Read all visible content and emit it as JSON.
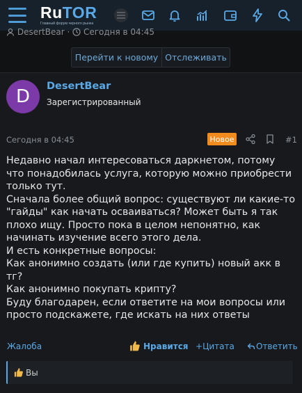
{
  "nav": {
    "logo_ru": "Ru",
    "logo_tor": "TOR",
    "logo_tagline": "Главный форум черного рынка",
    "icons": [
      "hamburger-icon",
      "mail-icon",
      "bell-icon",
      "chart-icon",
      "wallet-icon",
      "lightning-icon",
      "search-icon"
    ]
  },
  "thread": {
    "meta_author": "DesertBear",
    "meta_date": "Сегодня в 04:45"
  },
  "buttons": {
    "goto_new": "Перейти к новому",
    "watch": "Отслеживать"
  },
  "post": {
    "avatar_letter": "D",
    "username": "DesertBear",
    "user_title": "Зарегистрированный",
    "date": "Сегодня в 04:45",
    "new_badge": "Новое",
    "post_number": "#1",
    "message_lines": [
      "Недавно начал интересоваться даркнетом, потому что понадобилась услуга, которую можно приобрести только тут.",
      "Сначала более общий вопрос: существуют ли какие-то \"гайды\" как начать осваиваться? Может быть я так плохо ищу. Просто пока в целом непонятно, как начинать изучение всего этого дела.",
      "И есть конкретные вопросы:",
      "Как анонимно создать (или где купить) новый акк в тг?",
      "Как анонимно покупать крипту?",
      "Буду благодарен, если ответите на мои вопросы или просто подскажете, где искать на них ответы"
    ],
    "actions": {
      "report": "Жалоба",
      "like": "Нравится",
      "quote": "Цитата",
      "reply": "Ответить"
    },
    "likes_text": "Вы"
  },
  "colors": {
    "accent": "#5aa9e6",
    "badge": "#f28b1e",
    "avatar": "#7c3aa8",
    "nav_bg": "#17212b",
    "page_bg": "#111214"
  }
}
